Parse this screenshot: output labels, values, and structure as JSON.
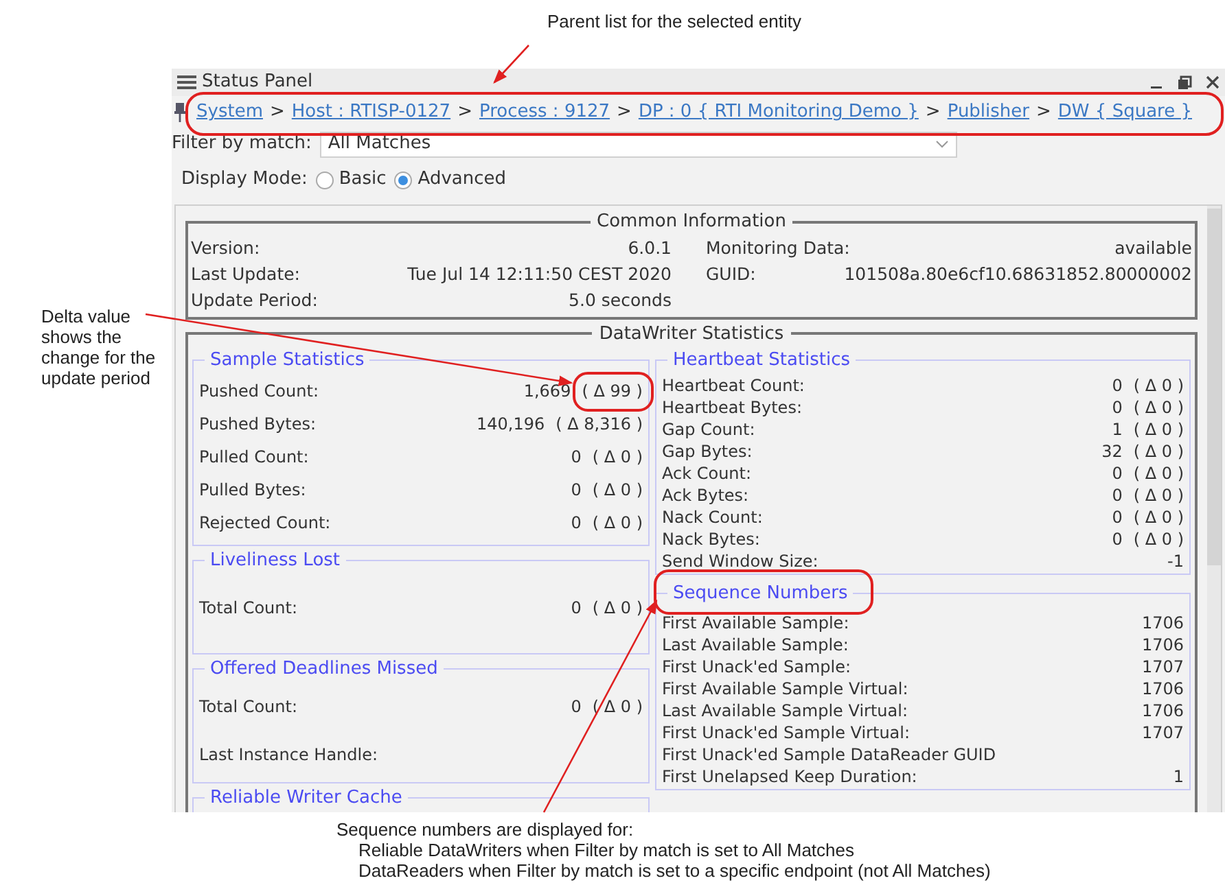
{
  "annotations": {
    "top": "Parent list for the selected entity",
    "left": "Delta value shows the change for the update period",
    "bottom": [
      "Sequence numbers are displayed for:",
      "Reliable DataWriters when Filter by match is set to All Matches",
      "DataReaders when Filter by match is set to a specific endpoint (not All Matches)"
    ]
  },
  "window": {
    "title": "Status Panel"
  },
  "breadcrumb": [
    {
      "kind": "link",
      "label": "System"
    },
    {
      "kind": "separator",
      "label": ">"
    },
    {
      "kind": "link",
      "label": "Host : RTISP-0127"
    },
    {
      "kind": "separator",
      "label": ">"
    },
    {
      "kind": "link",
      "label": "Process : 9127"
    },
    {
      "kind": "separator",
      "label": ">"
    },
    {
      "kind": "link",
      "label": "DP : 0 { RTI Monitoring Demo }"
    },
    {
      "kind": "separator",
      "label": ">"
    },
    {
      "kind": "link",
      "label": "Publisher"
    },
    {
      "kind": "separator",
      "label": ">"
    },
    {
      "kind": "link",
      "label": "DW { Square }"
    }
  ],
  "filter": {
    "label": "Filter by match:",
    "value": "All Matches"
  },
  "display_mode": {
    "label": "Display Mode:",
    "options": [
      {
        "label": "Basic",
        "selected": false
      },
      {
        "label": "Advanced",
        "selected": true
      }
    ]
  },
  "common_information": {
    "title": "Common Information",
    "left_rows": [
      {
        "label": "Version:",
        "value": "6.0.1"
      },
      {
        "label": "Last Update:",
        "value": "Tue Jul 14 12:11:50 CEST 2020"
      },
      {
        "label": "Update Period:",
        "value": "5.0 seconds"
      }
    ],
    "right_rows": [
      {
        "label": "Monitoring Data:",
        "value": "available"
      },
      {
        "label": "GUID:",
        "value": "101508a.80e6cf10.68631852.80000002"
      }
    ]
  },
  "datawriter_statistics": {
    "title": "DataWriter Statistics",
    "left_groups": [
      {
        "title": "Sample Statistics",
        "rows": [
          {
            "label": "Pushed Count:",
            "value": "1,669",
            "delta": "( Δ 99 )"
          },
          {
            "label": "Pushed Bytes:",
            "value": "140,196",
            "delta": "( Δ 8,316 )"
          },
          {
            "label": "Pulled Count:",
            "value": "0",
            "delta": "( Δ 0 )"
          },
          {
            "label": "Pulled Bytes:",
            "value": "0",
            "delta": "( Δ 0 )"
          },
          {
            "label": "Rejected Count:",
            "value": "0",
            "delta": "( Δ 0 )"
          }
        ]
      },
      {
        "title": "Liveliness Lost",
        "rows": [
          {
            "label": "Total Count:",
            "value": "0",
            "delta": "( Δ 0 )"
          }
        ]
      },
      {
        "title": "Offered Deadlines Missed",
        "rows": [
          {
            "label": "Total Count:",
            "value": "0",
            "delta": "( Δ 0 )"
          },
          {
            "label": "Last Instance Handle:"
          }
        ]
      },
      {
        "title": "Reliable Writer Cache"
      }
    ],
    "right_groups": [
      {
        "title": "Heartbeat Statistics",
        "rows": [
          {
            "label": "Heartbeat Count:",
            "value": "0",
            "delta": "( Δ 0 )"
          },
          {
            "label": "Heartbeat Bytes:",
            "value": "0",
            "delta": "( Δ 0 )"
          },
          {
            "label": "Gap Count:",
            "value": "1",
            "delta": "( Δ 0 )"
          },
          {
            "label": "Gap Bytes:",
            "value": "32",
            "delta": "( Δ 0 )"
          },
          {
            "label": "Ack Count:",
            "value": "0",
            "delta": "( Δ 0 )"
          },
          {
            "label": "Ack Bytes:",
            "value": "0",
            "delta": "( Δ 0 )"
          },
          {
            "label": "Nack Count:",
            "value": "0",
            "delta": "( Δ 0 )"
          },
          {
            "label": "Nack Bytes:",
            "value": "0",
            "delta": "( Δ 0 )"
          },
          {
            "label": "Send Window Size:",
            "value": "-1"
          }
        ]
      },
      {
        "title": "Sequence Numbers",
        "rows": [
          {
            "label": "First Available Sample:",
            "value": "1706"
          },
          {
            "label": "Last Available Sample:",
            "value": "1706"
          },
          {
            "label": "First Unack'ed Sample:",
            "value": "1707"
          },
          {
            "label": "First Available Sample Virtual:",
            "value": "1706"
          },
          {
            "label": "Last Available Sample Virtual:",
            "value": "1706"
          },
          {
            "label": "First Unack'ed Sample Virtual:",
            "value": "1707"
          },
          {
            "label": "First Unack'ed Sample DataReader GUID"
          },
          {
            "label": "First Unelapsed Keep Duration:",
            "value": "1"
          }
        ]
      }
    ]
  }
}
